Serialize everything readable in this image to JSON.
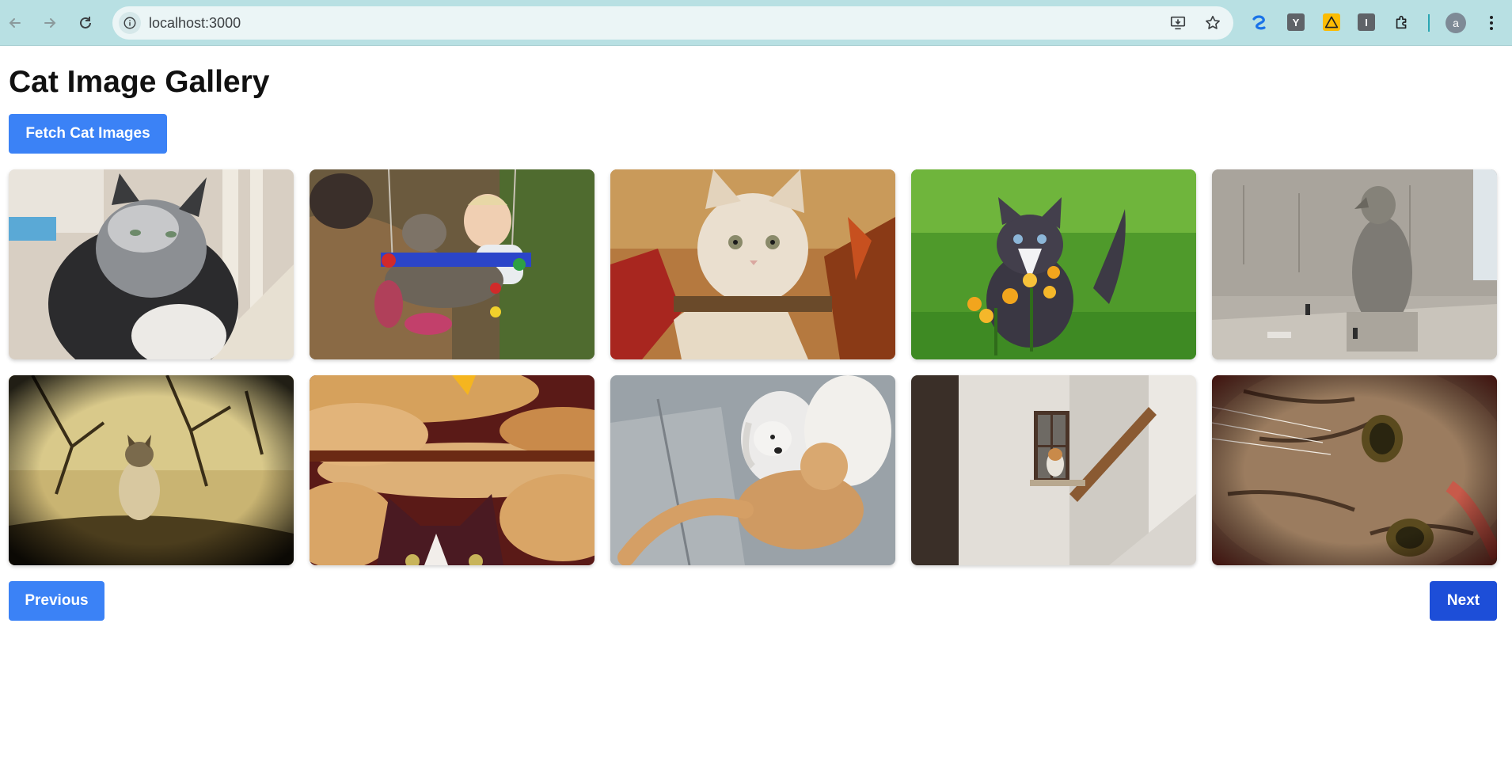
{
  "browser": {
    "url": "localhost:3000",
    "profile_initial": "a",
    "extensions": [
      {
        "name": "ext-blue-icon",
        "label": ""
      },
      {
        "name": "ext-y-icon",
        "label": "Y"
      },
      {
        "name": "ext-warning-icon",
        "label": ""
      },
      {
        "name": "ext-i-icon",
        "label": "I"
      },
      {
        "name": "extensions-puzzle-icon",
        "label": ""
      }
    ]
  },
  "page": {
    "title": "Cat Image Gallery",
    "fetch_button": "Fetch Cat Images",
    "previous_button": "Previous",
    "next_button": "Next"
  },
  "gallery": {
    "images": [
      {
        "name": "cat-image-1",
        "subject": "fluffy black and white cat indoors"
      },
      {
        "name": "cat-image-2",
        "subject": "baby holding tabby cat on a swing"
      },
      {
        "name": "cat-image-3",
        "subject": "cream kitten in autumn leaves"
      },
      {
        "name": "cat-image-4",
        "subject": "black and white kitten in grass with flowers"
      },
      {
        "name": "cat-image-5",
        "subject": "stone falcon statue with small cats"
      },
      {
        "name": "cat-image-6",
        "subject": "cat among bare tree branches, vintage tone"
      },
      {
        "name": "cat-image-7",
        "subject": "cat peeking among burger buns"
      },
      {
        "name": "cat-image-8",
        "subject": "white puppy and ginger cat on pavement"
      },
      {
        "name": "cat-image-9",
        "subject": "cat sitting in a window of a white building"
      },
      {
        "name": "cat-image-10",
        "subject": "close-up of tabby cat face"
      }
    ]
  },
  "colors": {
    "chrome_bg": "#b8e0e3",
    "primary_button": "#3b82f6",
    "next_button": "#1d4ed8"
  }
}
